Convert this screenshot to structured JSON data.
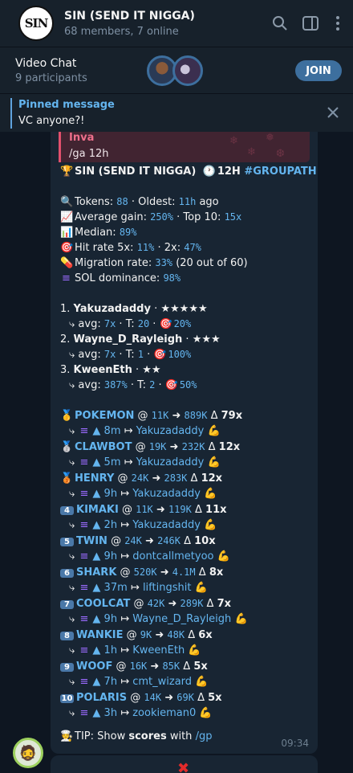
{
  "header": {
    "avatar_text": "SIN",
    "title": "SIN (SEND IT NIGGA)",
    "subtitle": "68 members, 7 online"
  },
  "video_chat": {
    "title": "Video Chat",
    "participants": "9 participants",
    "join_label": "JOIN"
  },
  "pinned": {
    "title": "Pinned message",
    "text": "VC anyone?!"
  },
  "message": {
    "reply_name": "Inva",
    "reply_text": "/ga 12h",
    "group_title": "SIN (SEND IT NIGGA)",
    "period": "12H",
    "hashtag": "#GROUPATH",
    "stats": {
      "tokens_label": "Tokens:",
      "tokens": "88",
      "oldest_label": "Oldest:",
      "oldest": "11h",
      "oldest_suffix": "ago",
      "avg_gain_label": "Average gain:",
      "avg_gain": "250%",
      "top10_label": "Top 10:",
      "top10": "15x",
      "median_label": "Median:",
      "median": "89%",
      "hit_label": "Hit rate 5x:",
      "hit5": "11%",
      "hit2_label": "2x:",
      "hit2": "47%",
      "mig_label": "Migration rate:",
      "mig": "33%",
      "mig_note": "(20 out of 60)",
      "sol_label": "SOL dominance:",
      "sol": "98%"
    },
    "leaders": [
      {
        "rank": "1.",
        "name": "Yakuzadaddy",
        "stars": "★★★★★",
        "avg": "7x",
        "t": "20",
        "hit": "20%"
      },
      {
        "rank": "2.",
        "name": "Wayne_D_Rayleigh",
        "stars": "★★★",
        "avg": "7x",
        "t": "1",
        "hit": "100%"
      },
      {
        "rank": "3.",
        "name": "KweenEth",
        "stars": "★★",
        "avg": "387%",
        "t": "2",
        "hit": "50%"
      }
    ],
    "calls": [
      {
        "badge": "🥇",
        "name": "POKEMON",
        "from": "11K",
        "to": "889K",
        "mult": "79x",
        "age": "8m",
        "caller": "Yakuzadaddy"
      },
      {
        "badge": "🥈",
        "name": "CLAWBOT",
        "from": "19K",
        "to": "232K",
        "mult": "12x",
        "age": "5m",
        "caller": "Yakuzadaddy"
      },
      {
        "badge": "🥉",
        "name": "HENRY",
        "from": "24K",
        "to": "283K",
        "mult": "12x",
        "age": "9h",
        "caller": "Yakuzadaddy"
      },
      {
        "badge": "4",
        "name": "KIMAKI",
        "from": "11K",
        "to": "119K",
        "mult": "11x",
        "age": "2h",
        "caller": "Yakuzadaddy"
      },
      {
        "badge": "5",
        "name": "TWIN",
        "from": "24K",
        "to": "246K",
        "mult": "10x",
        "age": "9h",
        "caller": "dontcallmetyoo"
      },
      {
        "badge": "6",
        "name": "SHARK",
        "from": "520K",
        "to": "4.1M",
        "mult": "8x",
        "age": "37m",
        "caller": "liftingshit"
      },
      {
        "badge": "7",
        "name": "COOLCAT",
        "from": "42K",
        "to": "289K",
        "mult": "7x",
        "age": "9h",
        "caller": "Wayne_D_Rayleigh"
      },
      {
        "badge": "8",
        "name": "WANKIE",
        "from": "9K",
        "to": "48K",
        "mult": "6x",
        "age": "1h",
        "caller": "KweenEth"
      },
      {
        "badge": "9",
        "name": "WOOF",
        "from": "16K",
        "to": "85K",
        "mult": "5x",
        "age": "7h",
        "caller": "cmt_wizard"
      },
      {
        "badge": "10",
        "name": "POLARIS",
        "from": "14K",
        "to": "69K",
        "mult": "5x",
        "age": "3h",
        "caller": "zookieman0"
      }
    ],
    "tip_prefix": "TIP: Show",
    "tip_bold": "scores",
    "tip_with": "with",
    "tip_cmd": "/gp",
    "time": "09:34"
  },
  "colors": {
    "background": "#0e1621",
    "panel": "#17212b",
    "bubble": "#182533",
    "accent": "#64b5ef",
    "join": "#3d6f9e",
    "reply_bar": "#e1506d"
  },
  "icons": [
    "search-icon",
    "sidebar-toggle-icon",
    "more-vert-icon",
    "close-icon",
    "trophy-icon",
    "clock-icon",
    "flexed-biceps-icon",
    "solana-icon",
    "red-x-icon"
  ]
}
